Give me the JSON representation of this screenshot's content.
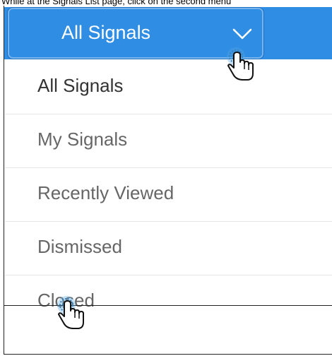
{
  "caption": "While at the Signals List page, click on the second menu",
  "dropdown": {
    "selected_label": "All Signals",
    "icon": "chevron-down-icon"
  },
  "menu": {
    "items": [
      {
        "label": "All Signals",
        "selected": true
      },
      {
        "label": "My Signals",
        "selected": false
      },
      {
        "label": "Recently Viewed",
        "selected": false
      },
      {
        "label": "Dismissed",
        "selected": false
      },
      {
        "label": "Closed",
        "selected": false
      }
    ]
  },
  "colors": {
    "accent": "#2f8de4",
    "text_selected": "#333333",
    "text_default": "#666666",
    "divider": "#e6e6e6"
  },
  "cursors": [
    "hand-pointer-icon",
    "hand-pointer-icon"
  ]
}
